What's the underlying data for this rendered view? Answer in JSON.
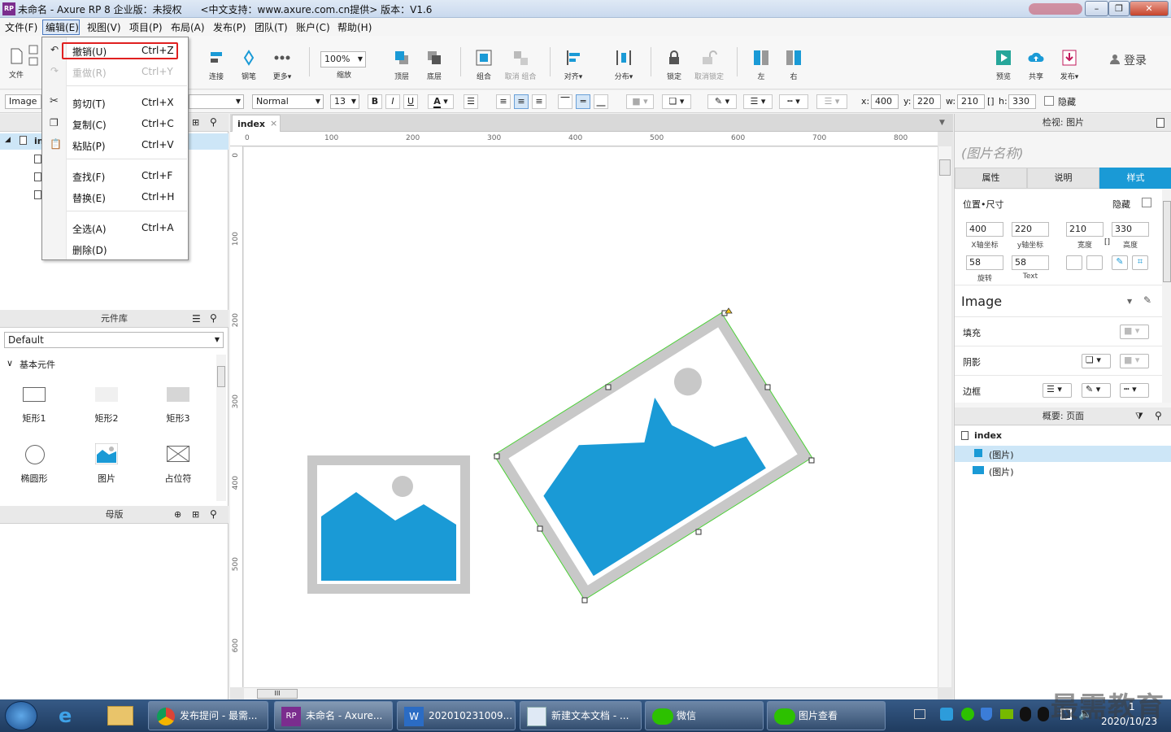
{
  "window": {
    "title": "未命名 - Axure RP 8 企业版：未授权      <中文支持：www.axure.com.cn提供> 版本：V1.6",
    "app_icon": "RP",
    "buttons": {
      "minimize": "–",
      "maximize": "❐",
      "close": "✕"
    }
  },
  "menubar": {
    "items": [
      "文件(F)",
      "编辑(E)",
      "视图(V)",
      "项目(P)",
      "布局(A)",
      "发布(P)",
      "团队(T)",
      "账户(C)",
      "帮助(H)"
    ],
    "active": "编辑(E)"
  },
  "edit_menu": {
    "items": [
      {
        "label": "撤销(U)",
        "shortcut": "Ctrl+Z",
        "enabled": true,
        "highlighted": true,
        "icon": "undo-icon"
      },
      {
        "label": "重做(R)",
        "shortcut": "Ctrl+Y",
        "enabled": false,
        "icon": "redo-icon"
      },
      {
        "label": "剪切(T)",
        "shortcut": "Ctrl+X",
        "enabled": true,
        "icon": "scissors-icon"
      },
      {
        "label": "复制(C)",
        "shortcut": "Ctrl+C",
        "enabled": true,
        "icon": "copy-icon"
      },
      {
        "label": "粘贴(P)",
        "shortcut": "Ctrl+V",
        "enabled": true,
        "icon": "paste-icon"
      },
      {
        "label": "查找(F)",
        "shortcut": "Ctrl+F",
        "enabled": true
      },
      {
        "label": "替换(E)",
        "shortcut": "Ctrl+H",
        "enabled": true
      },
      {
        "label": "全选(A)",
        "shortcut": "Ctrl+A",
        "enabled": true
      },
      {
        "label": "删除(D)",
        "shortcut": "",
        "enabled": true
      }
    ]
  },
  "toolbar": {
    "file": "文件",
    "connect": "连接",
    "pen": "钢笔",
    "more": "更多▾",
    "zoom_value": "100%",
    "zoom_label": "缩放",
    "top": "顶层",
    "bottom": "底层",
    "group": "组合",
    "ungroup": "取消 组合",
    "align": "对齐▾",
    "distribute": "分布▾",
    "lock": "锁定",
    "unlock": "取消锁定",
    "left": "左",
    "right": "右",
    "preview": "预览",
    "share": "共享",
    "publish": "发布▾",
    "login": "登录"
  },
  "formatbar": {
    "widget_type": "Image",
    "style": "Normal",
    "font_size": "13",
    "bold": "B",
    "italic": "I",
    "underline": "U",
    "x_label": "x:",
    "x": "400",
    "y_label": "y:",
    "y": "220",
    "w_label": "w:",
    "w": "210",
    "h_label": "h:",
    "h": "330",
    "hidden": "隐藏"
  },
  "pages_panel": {
    "root": "in",
    "children": 3
  },
  "library": {
    "title": "元件库",
    "selected": "Default",
    "section": "基本元件",
    "items": [
      "矩形1",
      "矩形2",
      "矩形3",
      "椭圆形",
      "图片",
      "占位符"
    ]
  },
  "masters": {
    "title": "母版"
  },
  "canvas": {
    "tab": "index",
    "ruler_h": [
      "0",
      "100",
      "200",
      "300",
      "400",
      "500",
      "600",
      "700",
      "800"
    ],
    "ruler_v": [
      "0",
      "100",
      "200",
      "300",
      "400",
      "500",
      "600"
    ]
  },
  "inspector": {
    "title": "检视: 图片",
    "name_placeholder": "(图片名称)",
    "tabs": [
      "属性",
      "说明",
      "样式"
    ],
    "active_tab": "样式",
    "pos_size": "位置•尺寸",
    "hidden": "隐藏",
    "x": "400",
    "x_label": "X轴坐标",
    "y": "220",
    "y_label": "y轴坐标",
    "w": "210",
    "w_label": "宽度",
    "h": "330",
    "h_label": "高度",
    "rotate": "58",
    "rotate_label": "旋转",
    "text_rotate": "58",
    "text_label": "Text",
    "style_name": "Image",
    "fill": "填充",
    "shadow": "阴影",
    "border": "边框"
  },
  "outline": {
    "title": "概要: 页面",
    "page": "index",
    "items": [
      "(图片)",
      "(图片)"
    ]
  },
  "taskbar": {
    "tasks": [
      "发布提问 - 最需...",
      "未命名 - Axure...",
      "20201023​1009...",
      "新建文本文档 - ...",
      "微信",
      "图片查看"
    ],
    "time": "2020/10/23",
    "clock_partial": "1",
    "watermark": "最需教育"
  },
  "colors": {
    "accent": "#1a9ad6",
    "image_gray": "#c8c8c8",
    "selection_green": "#4cd137",
    "highlight_red": "#e02020"
  }
}
